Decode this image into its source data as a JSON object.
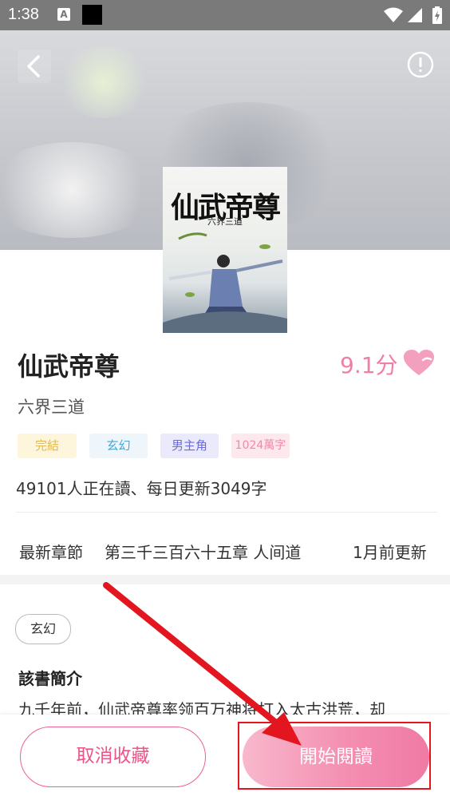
{
  "status_bar": {
    "time": "1:38",
    "notif_letter": "A"
  },
  "book": {
    "cover_title": "仙武帝尊",
    "cover_subtitle": "六界三道",
    "title": "仙武帝尊",
    "score": "9.1分",
    "author": "六界三道",
    "tags": [
      "完結",
      "玄幻",
      "男主角",
      "1024萬字"
    ],
    "readers_line": "49101人正在讀、每日更新3049字"
  },
  "latest": {
    "label": "最新章節",
    "chapter": "第三千三百六十五章 人间道",
    "time": "1月前更新"
  },
  "intro": {
    "genre": "玄幻",
    "heading": "該書簡介",
    "text": "九千年前，仙武帝尊率领百万神将打入太古洪荒，却"
  },
  "actions": {
    "cancel": "取消收藏",
    "read": "開始閱讀"
  },
  "colors": {
    "accent": "#f07ea6",
    "annotation": "#e3161f"
  },
  "icons": [
    "back-arrow-icon",
    "info-icon",
    "heart-icon",
    "wifi-icon",
    "signal-icon",
    "battery-icon"
  ]
}
